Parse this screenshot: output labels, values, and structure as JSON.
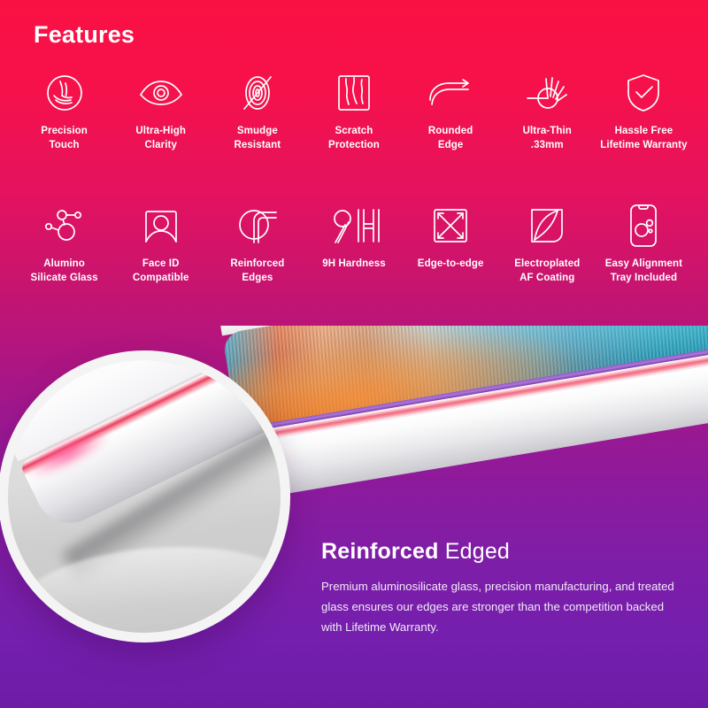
{
  "heading": {
    "title": "Features"
  },
  "theme": {
    "gradient_top": "#FA1144",
    "gradient_mid": "#B01580",
    "gradient_bottom": "#6E1CA8",
    "text_color": "#FFFFFF"
  },
  "features": {
    "row1": [
      {
        "icon": "precision-touch-icon",
        "label": "Precision\nTouch"
      },
      {
        "icon": "eye-clarity-icon",
        "label": "Ultra-High\nClarity"
      },
      {
        "icon": "smudge-resistant-icon",
        "label": "Smudge\nResistant"
      },
      {
        "icon": "scratch-protection-icon",
        "label": "Scratch\nProtection"
      },
      {
        "icon": "rounded-edge-icon",
        "label": "Rounded\nEdge"
      },
      {
        "icon": "ultra-thin-pinch-icon",
        "label": "Ultra-Thin\n.33mm"
      },
      {
        "icon": "shield-check-icon",
        "label": "Hassle Free\nLifetime Warranty"
      }
    ],
    "row2": [
      {
        "icon": "molecule-icon",
        "label": "Alumino\nSilicate Glass"
      },
      {
        "icon": "face-id-icon",
        "label": "Face ID\nCompatible"
      },
      {
        "icon": "reinforced-edges-icon",
        "label": "Reinforced\nEdges"
      },
      {
        "icon": "hardness-9h-icon",
        "label": "9H Hardness"
      },
      {
        "icon": "edge-to-edge-icon",
        "label": "Edge-to-edge"
      },
      {
        "icon": "electroplated-film-icon",
        "label": "Electroplated\nAF Coating"
      },
      {
        "icon": "alignment-tray-icon",
        "label": "Easy Alignment\nTray Included"
      }
    ]
  },
  "promo": {
    "title_strong": "Reinforced",
    "title_light": "Edged",
    "body": "Premium aluminosilicate glass, precision manufacturing, and treated glass ensures our edges are stronger than the competition backed with Lifetime Warranty."
  }
}
